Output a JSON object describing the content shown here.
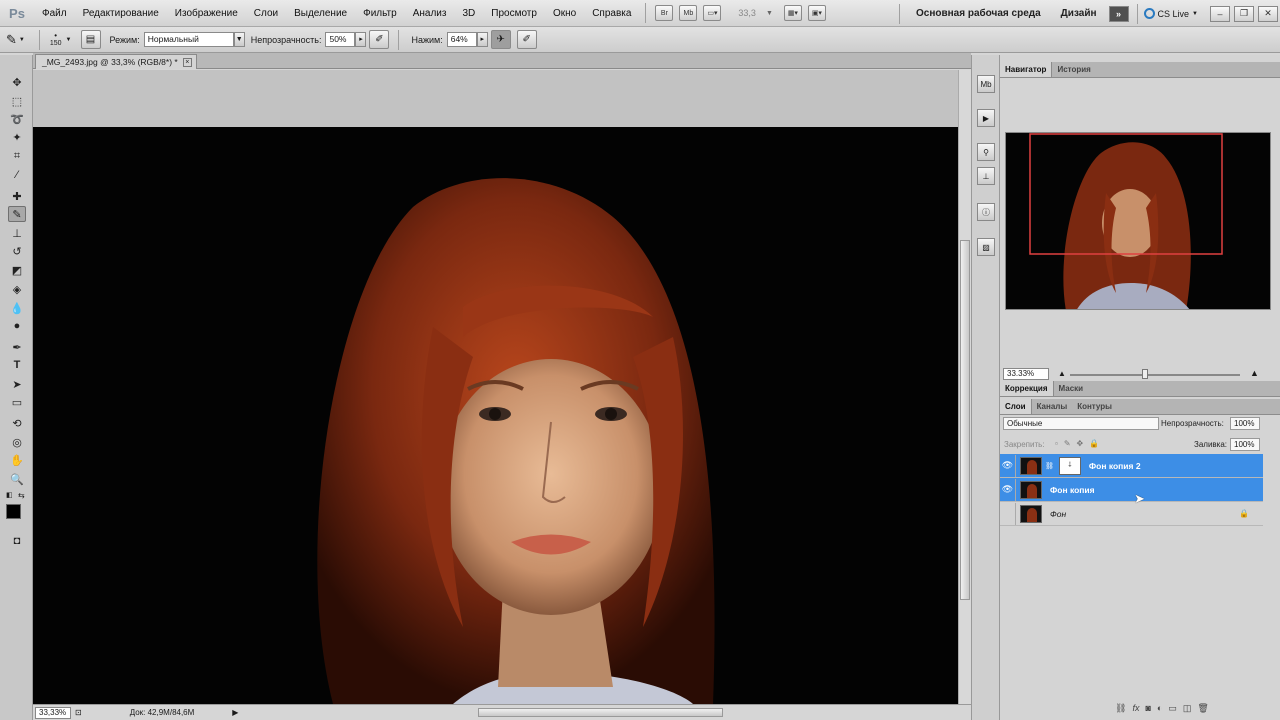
{
  "app": {
    "logo": "Ps"
  },
  "menu": [
    "Файл",
    "Редактирование",
    "Изображение",
    "Слои",
    "Выделение",
    "Фильтр",
    "Анализ",
    "3D",
    "Просмотр",
    "Окно",
    "Справка"
  ],
  "menubar_tools": {
    "br": "Br",
    "mb": "Mb",
    "zoom": "33,3"
  },
  "workspace": {
    "main": "Основная рабочая среда",
    "design": "Дизайн",
    "more": "»",
    "cs_live": "CS Live"
  },
  "options": {
    "brush_size": "150",
    "mode_label": "Режим:",
    "mode_value": "Нормальный",
    "opacity_label": "Непрозрачность:",
    "opacity_value": "50%",
    "pressure_label": "Нажим:",
    "pressure_value": "64%"
  },
  "document": {
    "tab_title": "_MG_2493.jpg @ 33,3% (RGB/8*) *",
    "zoom_status": "33,33%",
    "doc_info": "Док: 42,9M/84,6M"
  },
  "navigator": {
    "tabs": [
      "Навигатор",
      "История"
    ],
    "zoom": "33.33%"
  },
  "adjustments": {
    "tabs": [
      "Коррекция",
      "Маски"
    ]
  },
  "layers_panel": {
    "tabs": [
      "Слои",
      "Каналы",
      "Контуры"
    ],
    "blend_mode": "Обычные",
    "opacity_label": "Непрозрачность:",
    "opacity_value": "100%",
    "lock_label": "Закрепить:",
    "fill_label": "Заливка:",
    "fill_value": "100%",
    "layers": [
      {
        "name": "Фон копия 2",
        "visible": true,
        "selected": true,
        "has_mask": true
      },
      {
        "name": "Фон копия",
        "visible": true,
        "selected": true,
        "has_mask": false
      },
      {
        "name": "Фон",
        "visible": false,
        "selected": false,
        "has_mask": false,
        "locked": true
      }
    ]
  },
  "colors": {
    "selection": "#3d8ee6",
    "nav_frame": "#e04040",
    "hair": "#8a2e12",
    "skin": "#d9a785"
  }
}
